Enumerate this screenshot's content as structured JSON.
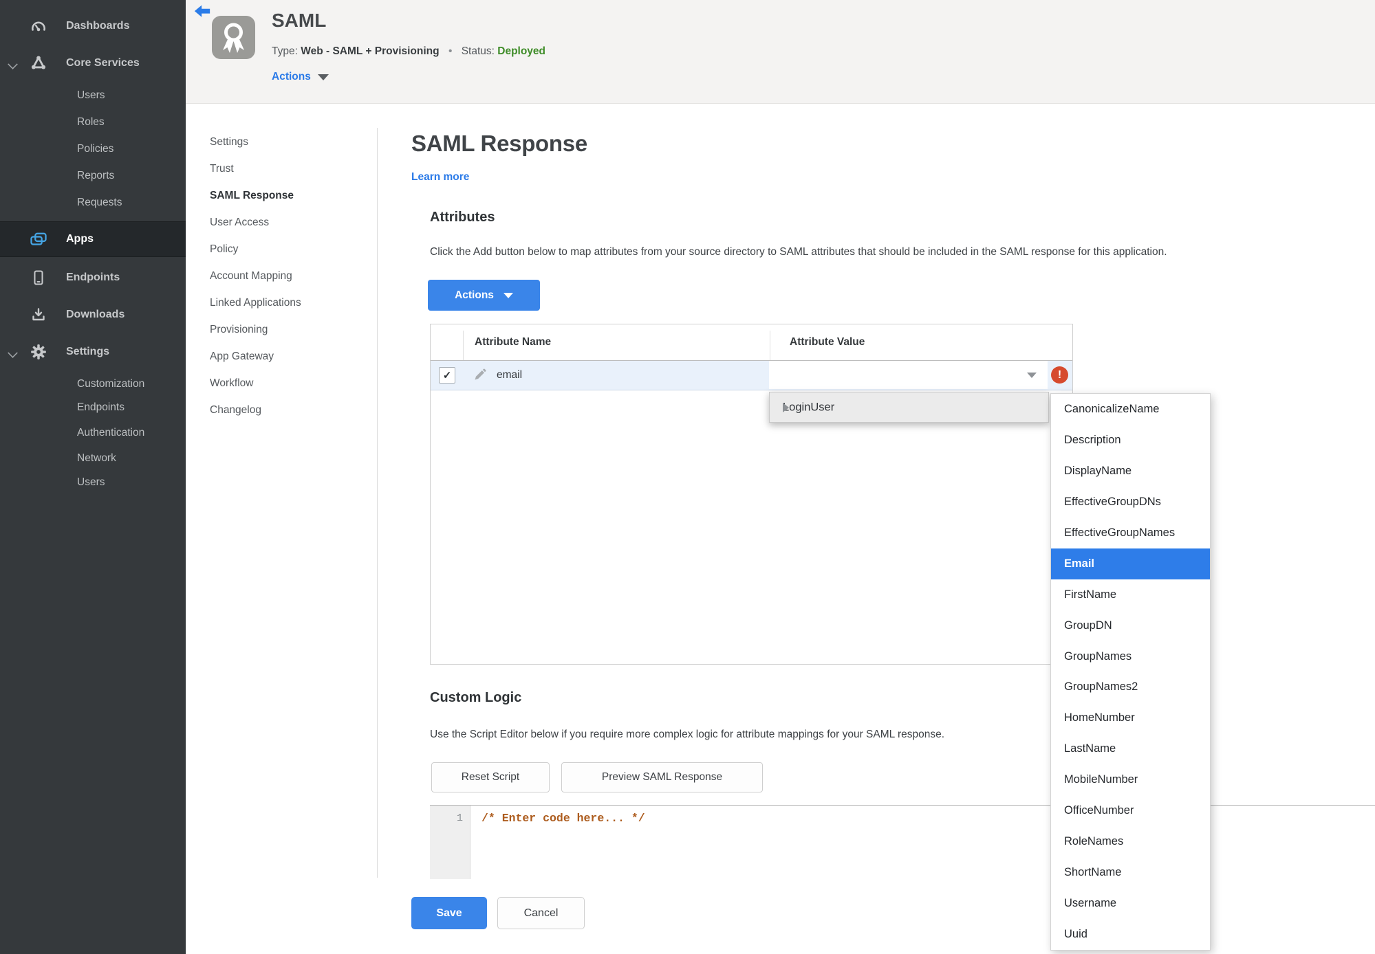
{
  "sidebar": {
    "items": [
      "Dashboards",
      "Core Services",
      "Users",
      "Roles",
      "Policies",
      "Reports",
      "Requests",
      "Apps",
      "Endpoints",
      "Downloads",
      "Settings",
      "Customization",
      "Endpoints",
      "Authentication",
      "Network",
      "Users"
    ]
  },
  "header": {
    "title": "SAML",
    "type_label": "Type:",
    "type_value": "Web - SAML + Provisioning",
    "dot": "•",
    "status_label": "Status:",
    "status_value": "Deployed",
    "actions_label": "Actions"
  },
  "subnav": {
    "items": [
      "Settings",
      "Trust",
      "SAML Response",
      "User Access",
      "Policy",
      "Account Mapping",
      "Linked Applications",
      "Provisioning",
      "App Gateway",
      "Workflow",
      "Changelog"
    ],
    "active": "SAML Response"
  },
  "main": {
    "title": "SAML Response",
    "learn_more": "Learn more",
    "attributes": {
      "heading": "Attributes",
      "description": "Click the Add button below to map attributes from your source directory to SAML attributes that should be included in the SAML response for this application.",
      "actions_button": "Actions"
    },
    "table": {
      "columns": [
        "Attribute Name",
        "Attribute Value"
      ],
      "row": {
        "name": "email",
        "checked": true,
        "value": ""
      }
    },
    "custom_logic": {
      "heading": "Custom Logic",
      "description": "Use the Script Editor below if you require more complex logic for attribute mappings for your SAML response.",
      "reset_button": "Reset Script",
      "preview_button": "Preview SAML Response",
      "editor": {
        "line_number": "1",
        "code": "/* Enter code here... */"
      }
    },
    "save_button": "Save",
    "cancel_button": "Cancel"
  },
  "menu": {
    "trigger": "LoginUser",
    "selected": "Email",
    "options": [
      "CanonicalizeName",
      "Description",
      "DisplayName",
      "EffectiveGroupDNs",
      "EffectiveGroupNames",
      "Email",
      "FirstName",
      "GroupDN",
      "GroupNames",
      "GroupNames2",
      "HomeNumber",
      "LastName",
      "MobileNumber",
      "OfficeNumber",
      "RoleNames",
      "ShortName",
      "Username",
      "Uuid"
    ]
  },
  "glyphs": {
    "check": "✓",
    "error": "!"
  },
  "colors": {
    "accent_blue": "#2c7be8",
    "button_blue": "#3a85e9",
    "highlight_blue": "#2e7de9",
    "status_green": "#3e8c28",
    "error_red": "#d64a2e",
    "code_orange": "#ad5c1e",
    "sidebar_bg": "#35393c",
    "row_highlight": "#e9f1fb"
  },
  "icons": [
    "back-icon",
    "ribbon-badge-icon",
    "gauge-icon",
    "molecule-icon",
    "apps-icon",
    "tablet-icon",
    "download-tray-icon",
    "gear-icon",
    "chevron-down-icon",
    "caret-down-icon",
    "pencil-icon",
    "submenu-arrow-icon",
    "error-icon",
    "checkbox-check-icon"
  ]
}
